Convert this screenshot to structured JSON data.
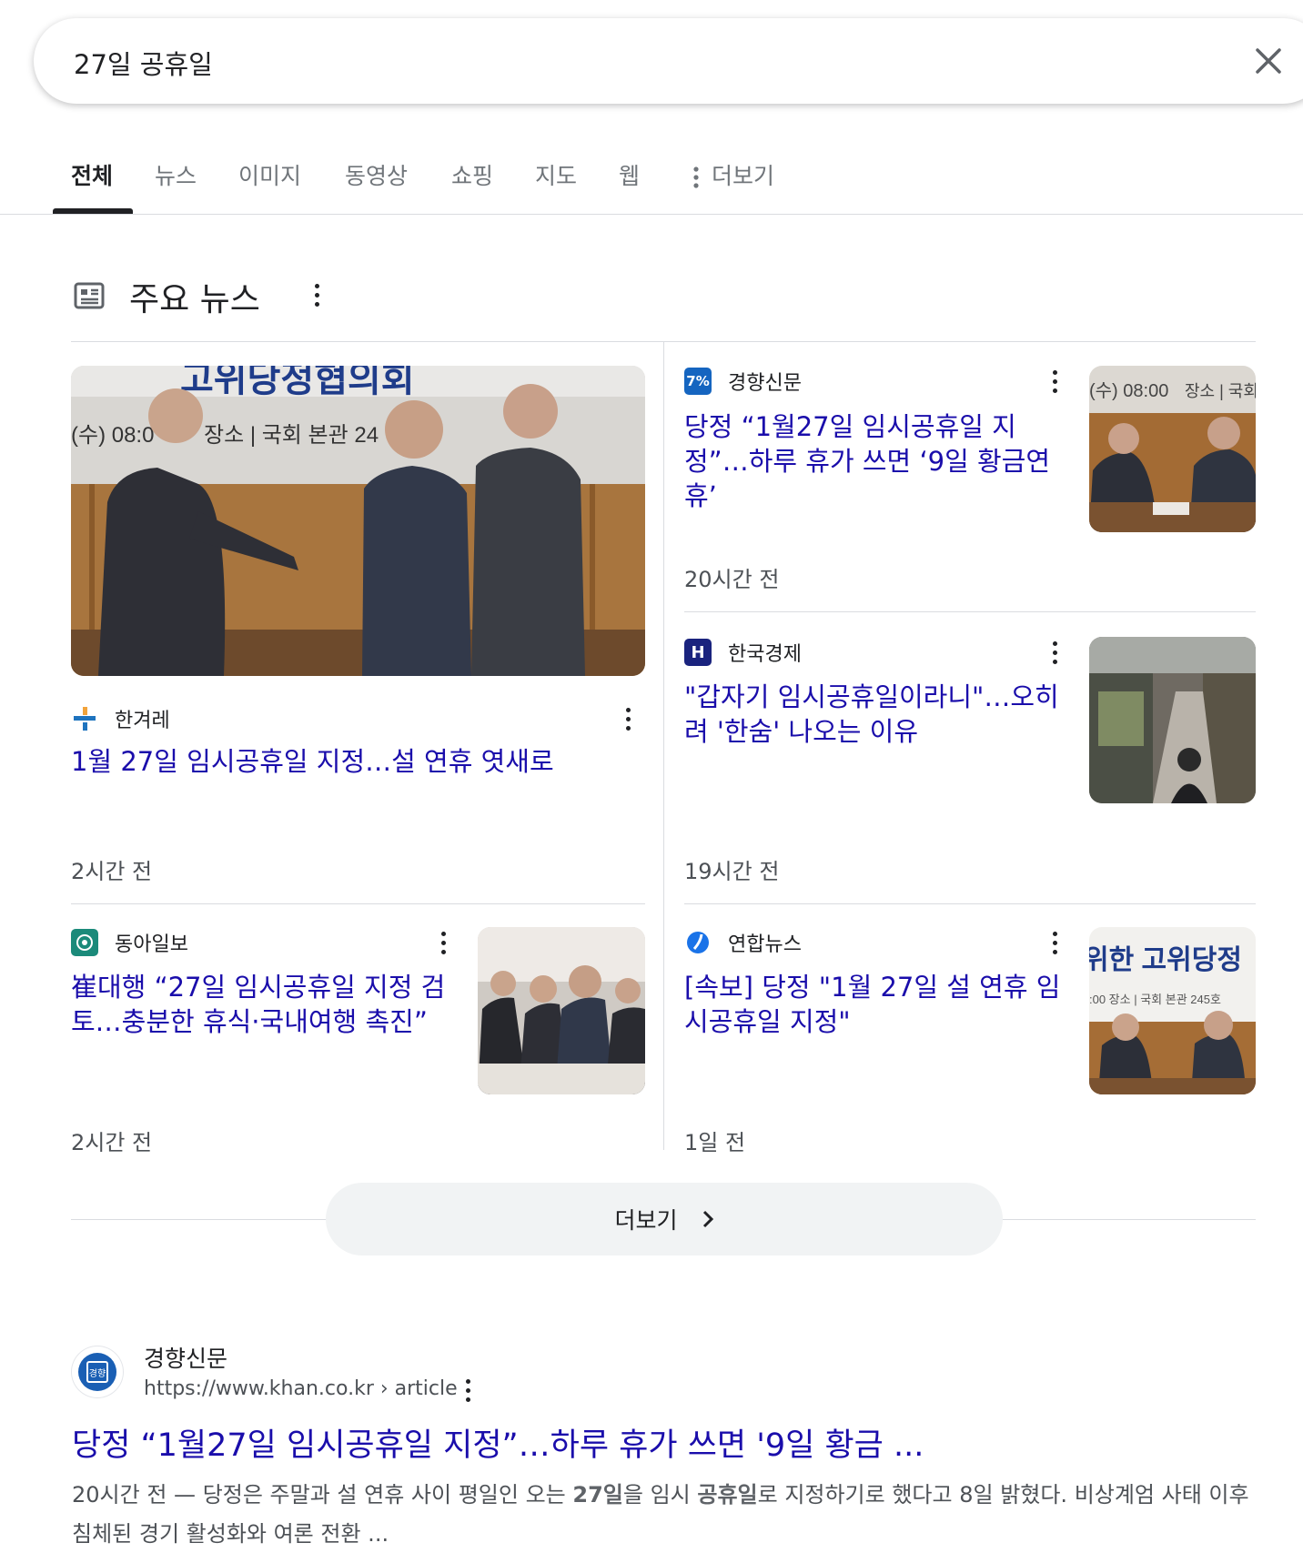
{
  "search": {
    "query": "27일 공휴일"
  },
  "tabs": [
    {
      "label": "전체",
      "active": true
    },
    {
      "label": "뉴스"
    },
    {
      "label": "이미지"
    },
    {
      "label": "동영상"
    },
    {
      "label": "쇼핑"
    },
    {
      "label": "지도"
    },
    {
      "label": "웹"
    },
    {
      "label": "더보기"
    }
  ],
  "top_stories": {
    "title": "주요 뉴스",
    "items": [
      {
        "source": "한겨레",
        "headline": "1월 27일 임시공휴일 지정…설 연휴 엿새로",
        "time": "2시간 전",
        "logo_color": "#1e73be",
        "image_text": [
          "(수) 08:0",
          "장소 | 국회 본관 24"
        ]
      },
      {
        "source": "경향신문",
        "headline": "당정 “1월27일 임시공휴일 지정”…하루 휴가 쓰면 ‘9일 황금연휴’",
        "time": "20시간 전",
        "logo_color": "#1565c0",
        "logo_text": "7%",
        "image_text": [
          "(수) 08:00",
          "장소 | 국회"
        ]
      },
      {
        "source": "한국경제",
        "headline": "\"갑자기 임시공휴일이라니\"…오히려 '한숨' 나오는 이유",
        "time": "19시간 전",
        "logo_color": "#1a237e",
        "logo_text": "H"
      },
      {
        "source": "동아일보",
        "headline": "崔대행 “27일 임시공휴일 지정 검토…충분한 휴식·국내여행 촉진”",
        "time": "2시간 전",
        "logo_color": "#1b8a7a"
      },
      {
        "source": "연합뉴스",
        "headline": "[속보] 당정 \"1월 27일 설 연휴 임시공휴일 지정\"",
        "time": "1일 전",
        "logo_color": "#1a73e8",
        "image_text": [
          "위한 고위당정",
          ":00 장소 | 국회 본관 245호"
        ]
      }
    ],
    "more_label": "더보기"
  },
  "result": {
    "site_name": "경향신문",
    "url": "https://www.khan.co.kr › article",
    "favicon_text": "경향",
    "title": "당정 “1월27일 임시공휴일 지정”…하루 휴가 쓰면 '9일 황금 ...",
    "snippet_time": "20시간 전 —",
    "snippet_parts": [
      "당정은 주말과 설 연휴 사이 평일인 오는 ",
      "27일",
      "을 임시 ",
      "공휴일",
      "로 지정하기로 했다고 8일 밝혔다. 비상계엄 사태 이후 침체된 경기 활성화와 여론 전환 ..."
    ]
  },
  "colors": {
    "link": "#1a0dab",
    "meta": "#4d5156",
    "divider": "#dadce0"
  }
}
